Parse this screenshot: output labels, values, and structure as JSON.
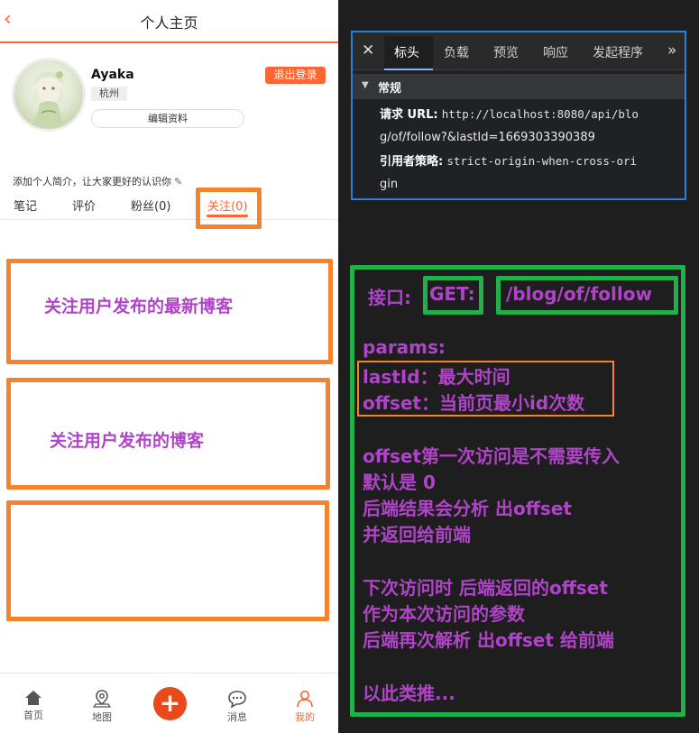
{
  "header": {
    "back_icon": "chevron-left-icon",
    "title": "个人主页"
  },
  "profile": {
    "name": "Ayaka",
    "city": "杭州",
    "edit_label": "编辑资料",
    "logout_label": "退出登录",
    "intro": "添加个人简介，让大家更好的认识你"
  },
  "tabs": [
    {
      "label": "笔记"
    },
    {
      "label": "评价"
    },
    {
      "label": "粉丝(0)"
    },
    {
      "label": "关注(0)"
    }
  ],
  "annotations_left": {
    "box1": "关注用户发布的最新博客",
    "box2": "关注用户发布的博客"
  },
  "tabbar": [
    {
      "label": "首页",
      "icon": "home-icon"
    },
    {
      "label": "地图",
      "icon": "map-pin-icon"
    },
    {
      "label": "",
      "icon": "plus-icon"
    },
    {
      "label": "消息",
      "icon": "message-icon"
    },
    {
      "label": "我的",
      "icon": "user-icon"
    }
  ],
  "devtools": {
    "tabs": [
      "标头",
      "负载",
      "预览",
      "响应",
      "发起程序"
    ],
    "section": "常规",
    "request_url_label": "请求 URL:",
    "request_url_line1": "http://localhost:8080/api/blo",
    "request_url_line2": "g/of/follow?&lastId=1669303390389",
    "referrer_label": "引用者策略:",
    "referrer_line1": "strict-origin-when-cross-ori",
    "referrer_line2": "gin"
  },
  "notes": {
    "api_label": "接口:",
    "method": "GET:",
    "path": "/blog/of/follow",
    "params_title": "params:",
    "param1": "lastId：最大时间",
    "param2": "offset：当前页最小id次数",
    "p1_l1": "offset第一次访问是不需要传入",
    "p1_l2": "默认是 0",
    "p1_l3": "后端结果会分析 出offset",
    "p1_l4": "并返回给前端",
    "p2_l1": "下次访问时 后端返回的offset",
    "p2_l2": "作为本次访问的参数",
    "p2_l3": "后端再次解析 出offset 给前端",
    "p3_l1": "以此类推..."
  },
  "colors": {
    "accent": "#ff6633",
    "annotation_orange": "#f7822a",
    "annotation_green": "#22b04a",
    "annotation_text": "#b044c8"
  }
}
